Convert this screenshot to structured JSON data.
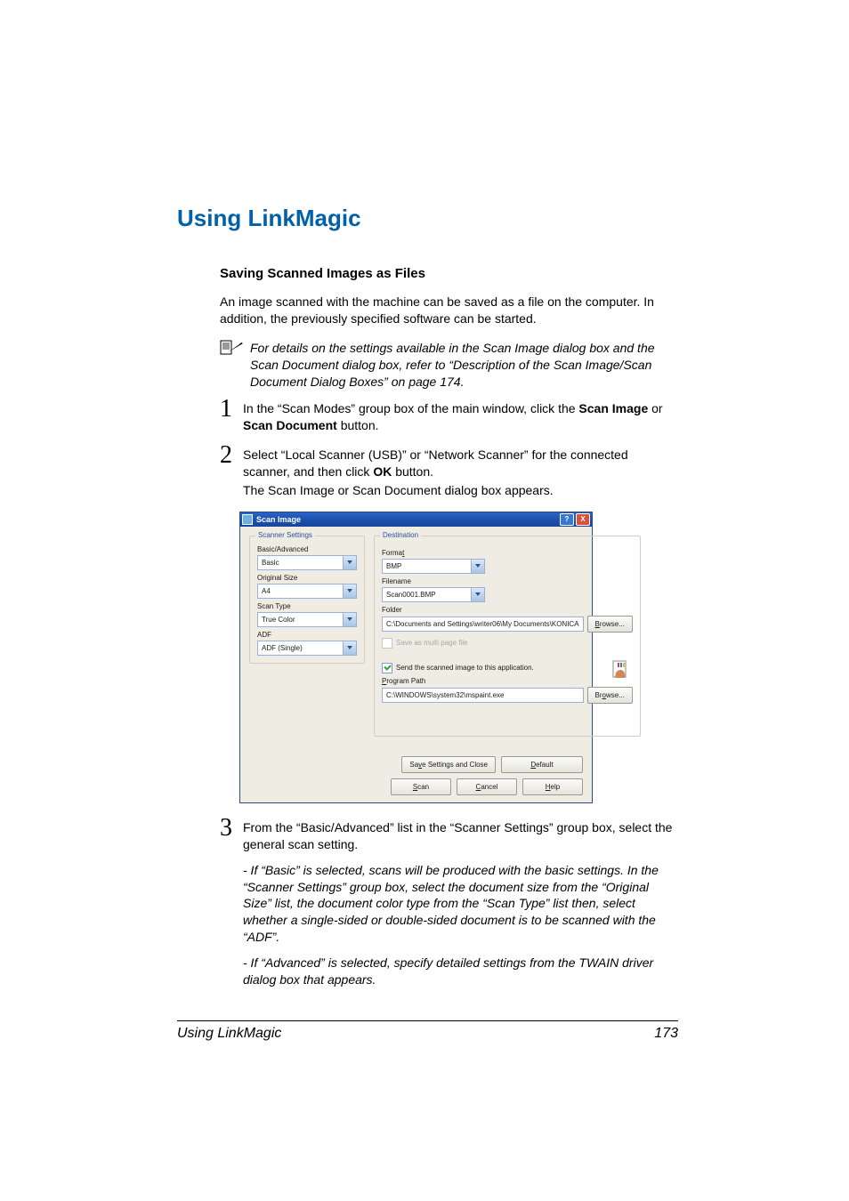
{
  "heading": "Using LinkMagic",
  "subheading": "Saving Scanned Images as Files",
  "intro": "An image scanned with the machine can be saved as a file on the computer. In addition, the previously specified software can be started.",
  "note": "For details on the settings available in the Scan Image dialog box and the Scan Document dialog box, refer to “Description of the Scan Image/Scan Document Dialog Boxes” on page 174.",
  "steps": {
    "s1": {
      "num": "1",
      "pre": "In the “Scan Modes” group box of the main window, click the ",
      "b1": "Scan Image",
      "mid": " or ",
      "b2": "Scan Document",
      "post": " button."
    },
    "s2": {
      "num": "2",
      "line1a": "Select “Local Scanner (USB)” or “Network Scanner” for the connected scanner, and then click ",
      "line1b": "OK",
      "line1c": " button.",
      "line2": "The Scan Image or Scan Document dialog box appears."
    },
    "s3": {
      "num": "3",
      "main": "From the “Basic/Advanced” list in the “Scanner Settings” group box, select the general scan setting.",
      "it1": "- If “Basic” is selected, scans will be produced with the basic settings. In the “Scanner Settings” group box, select the document size from the “Original Size” list, the document color type from the “Scan Type” list then, select whether a single-sided or double-sided document is to be scanned with the “ADF”.",
      "it2": "- If “Advanced” is selected, specify detailed settings from the TWAIN driver dialog box that appears."
    }
  },
  "dialog": {
    "title": "Scan Image",
    "help": "?",
    "close": "X",
    "scanner_settings": {
      "title": "Scanner Settings",
      "basic_advanced_label": "Basic/Advanced",
      "basic_advanced_value": "Basic",
      "original_size_label": "Original Size",
      "original_size_value": "A4",
      "scan_type_label": "Scan Type",
      "scan_type_value": "True Color",
      "adf_label": "ADF",
      "adf_value": "ADF (Single)"
    },
    "destination": {
      "title": "Destination",
      "format_u": "t",
      "format_label": "Forma",
      "format_value": "BMP",
      "filename_label": "Filename",
      "filename_value": "Scan0001.BMP",
      "folder_label": "Folder",
      "folder_value": "C:\\Documents and Settings\\writer06\\My Documents\\KONICA",
      "browse1": "rowse...",
      "browse1_u": "B",
      "multi_label": "Save as multi page file",
      "send_label": "end the scanned image to this application.",
      "send_u": "S",
      "program_path_label": "rogram Path",
      "program_path_u": "P",
      "program_path_value": "C:\\WINDOWS\\system32\\mspaint.exe",
      "browse2": "owse...",
      "browse2_u": "Br"
    },
    "buttons": {
      "save_close": "e Settings and Close",
      "save_close_pre": "Sav",
      "default": "efault",
      "default_u": "D",
      "scan": "can",
      "scan_u": "S",
      "cancel": "ancel",
      "cancel_u": "C",
      "help": "elp",
      "help_u": "H"
    }
  },
  "footer": {
    "text": "Using LinkMagic",
    "page": "173"
  }
}
